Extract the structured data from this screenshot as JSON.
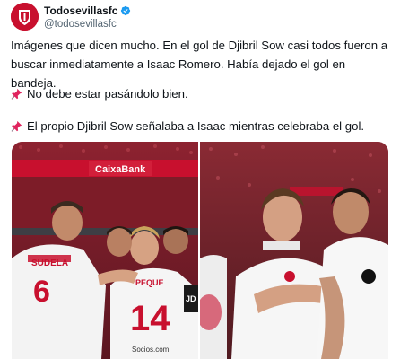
{
  "tweet": {
    "display_name": "Todosevillasfc",
    "handle": "@todosevillasfc",
    "paragraph1": "Imágenes que dicen mucho. En el gol de Djibril Sow casi todos fueron a buscar inmediatamente a Isaac Romero. Había dejado el gol en bandeja.",
    "paragraph2": "No debe estar pasándolo bien.",
    "paragraph3": "El propio Djibril Sow señalaba a Isaac mientras celebraba el gol.",
    "pin_icon": "pushpin-icon",
    "verified_icon": "verified-badge-icon"
  },
  "media": {
    "photo1": {
      "banner_text": "CaixaBank",
      "shirt_name": "SUDELA",
      "shirt_number_left": "6",
      "shirt_number_center": "14",
      "shirt_name_center": "PEQUE",
      "sponsor_text": "Socios.com"
    },
    "photo2": {}
  },
  "colors": {
    "accent": "#1d9bf0",
    "brand_red": "#c8102e",
    "text_secondary": "#536471"
  }
}
